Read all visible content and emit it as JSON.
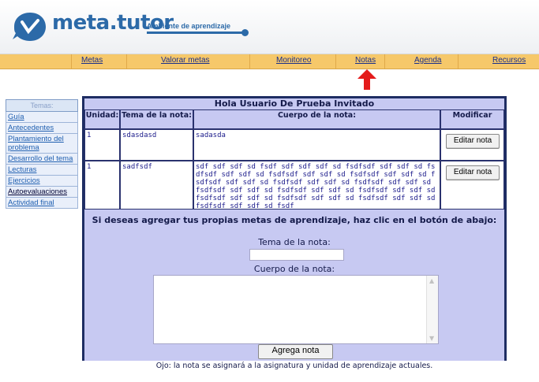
{
  "brand": {
    "name": "meta.tutor",
    "tagline": "Ambiente de aprendizaje"
  },
  "colors": {
    "brand": "#2c6aa8",
    "navbar": "#f6c86a",
    "panel": "#1e2d63",
    "panel_bg": "#c7c9f2",
    "arrow": "#e41b1b"
  },
  "nav": {
    "items": [
      "Metas",
      "Valorar metas",
      "Monitoreo",
      "Notas",
      "Agenda",
      "Recursos"
    ]
  },
  "sidebar": {
    "header": "Temas:",
    "items": [
      "Guía",
      "Antecedentes",
      "Plantamiento del problema",
      "Desarrollo del tema",
      "Lecturas",
      "Ejercicios",
      "Autoevaluaciones",
      "Actividad final"
    ]
  },
  "main": {
    "greeting": "Hola Usuario De Prueba Invitado",
    "table": {
      "headers": [
        "Unidad:",
        "Tema de la nota:",
        "Cuerpo de la nota:",
        "Modificar"
      ],
      "rows": [
        {
          "unidad": "1",
          "tema": "sdasdasd",
          "cuerpo": "sadasda",
          "action": "Editar nota"
        },
        {
          "unidad": "1",
          "tema": "sadfsdf",
          "cuerpo": "sdf sdf sdf sd fsdf sdf sdf sdf sd fsdfsdf sdf sdf sd fsdfsdf sdf sdf sd fsdfsdf sdf sdf sd fsdfsdf sdf sdf sd fsdfsdf sdf sdf sd fsdfsdf sdf sdf sd fsdfsdf sdf sdf sd fsdfsdf sdf sdf sd fsdfsdf sdf sdf sd fsdfsdf sdf sdf sd fsdfsdf sdf sdf sd fsdfsdf sdf sdf sd fsdfsdf sdf sdf sd fsdfsdf sdf sdf sd fsdf",
          "action": "Editar nota"
        }
      ]
    },
    "invite": "Si deseas agregar tus propias metas de aprendizaje, haz clic en el botón de abajo:",
    "form": {
      "tema_label": "Tema de la nota:",
      "tema_value": "",
      "cuerpo_label": "Cuerpo de la nota:",
      "cuerpo_value": "",
      "submit": "Agrega nota",
      "note": "Ojo: la nota se asignará a la asignatura y unidad de aprendizaje actuales."
    }
  }
}
